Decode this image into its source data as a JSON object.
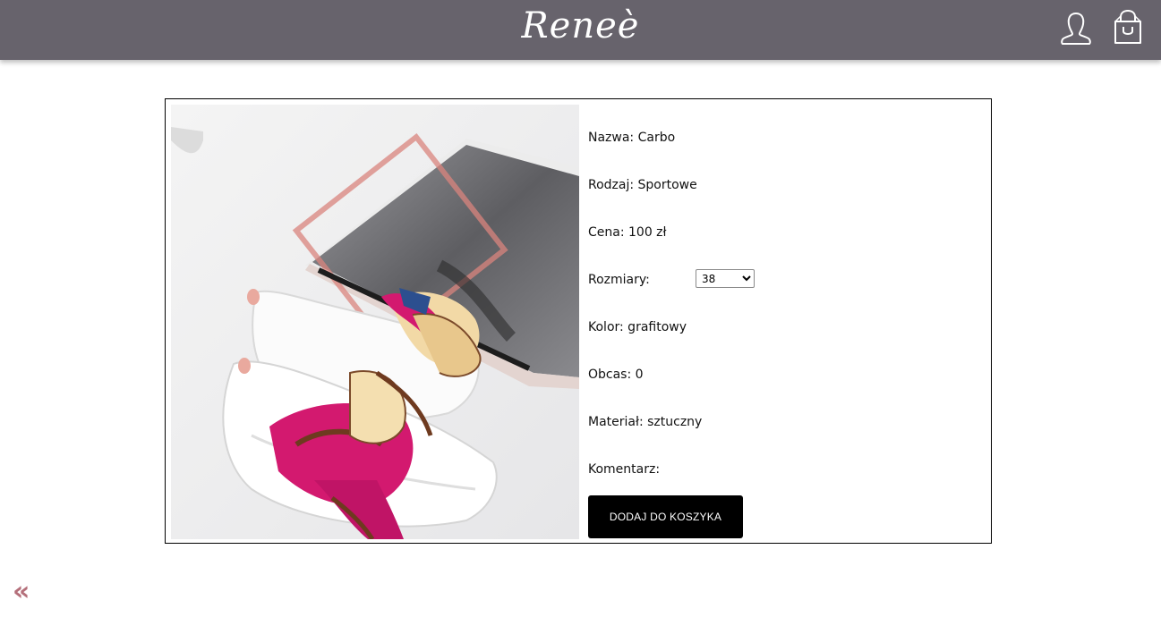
{
  "header": {
    "logo": "Reneè",
    "user_icon": "user-icon",
    "cart_icon": "shopping-bag-icon"
  },
  "product": {
    "image_icon": "product-photo",
    "details": [
      "Nazwa: Carbo",
      "Rodzaj: Sportowe",
      "Cena: 100 zł",
      "Rozmiary:",
      "Kolor: grafitowy",
      "Obcas: 0",
      "Materiał: sztuczny",
      "Komentarz:"
    ],
    "size_selected": "38",
    "add_button": "DODAJ DO KOSZYKA"
  },
  "nav": {
    "back": "«"
  },
  "colors": {
    "header_bg": "#67636c",
    "button_bg": "#000000",
    "back_arrow": "#b46f7a"
  }
}
